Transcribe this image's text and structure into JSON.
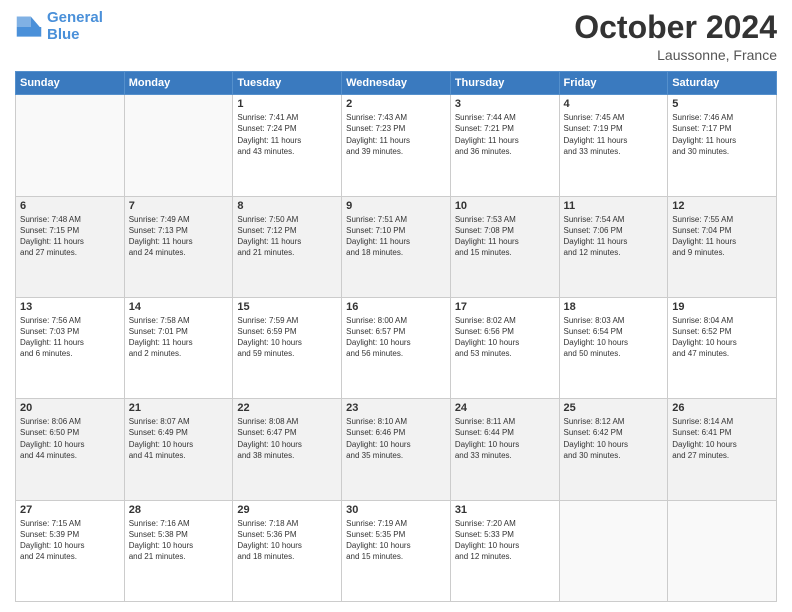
{
  "header": {
    "logo_line1": "General",
    "logo_line2": "Blue",
    "month": "October 2024",
    "location": "Laussonne, France"
  },
  "weekdays": [
    "Sunday",
    "Monday",
    "Tuesday",
    "Wednesday",
    "Thursday",
    "Friday",
    "Saturday"
  ],
  "weeks": [
    [
      {
        "day": "",
        "info": ""
      },
      {
        "day": "",
        "info": ""
      },
      {
        "day": "1",
        "info": "Sunrise: 7:41 AM\nSunset: 7:24 PM\nDaylight: 11 hours\nand 43 minutes."
      },
      {
        "day": "2",
        "info": "Sunrise: 7:43 AM\nSunset: 7:23 PM\nDaylight: 11 hours\nand 39 minutes."
      },
      {
        "day": "3",
        "info": "Sunrise: 7:44 AM\nSunset: 7:21 PM\nDaylight: 11 hours\nand 36 minutes."
      },
      {
        "day": "4",
        "info": "Sunrise: 7:45 AM\nSunset: 7:19 PM\nDaylight: 11 hours\nand 33 minutes."
      },
      {
        "day": "5",
        "info": "Sunrise: 7:46 AM\nSunset: 7:17 PM\nDaylight: 11 hours\nand 30 minutes."
      }
    ],
    [
      {
        "day": "6",
        "info": "Sunrise: 7:48 AM\nSunset: 7:15 PM\nDaylight: 11 hours\nand 27 minutes."
      },
      {
        "day": "7",
        "info": "Sunrise: 7:49 AM\nSunset: 7:13 PM\nDaylight: 11 hours\nand 24 minutes."
      },
      {
        "day": "8",
        "info": "Sunrise: 7:50 AM\nSunset: 7:12 PM\nDaylight: 11 hours\nand 21 minutes."
      },
      {
        "day": "9",
        "info": "Sunrise: 7:51 AM\nSunset: 7:10 PM\nDaylight: 11 hours\nand 18 minutes."
      },
      {
        "day": "10",
        "info": "Sunrise: 7:53 AM\nSunset: 7:08 PM\nDaylight: 11 hours\nand 15 minutes."
      },
      {
        "day": "11",
        "info": "Sunrise: 7:54 AM\nSunset: 7:06 PM\nDaylight: 11 hours\nand 12 minutes."
      },
      {
        "day": "12",
        "info": "Sunrise: 7:55 AM\nSunset: 7:04 PM\nDaylight: 11 hours\nand 9 minutes."
      }
    ],
    [
      {
        "day": "13",
        "info": "Sunrise: 7:56 AM\nSunset: 7:03 PM\nDaylight: 11 hours\nand 6 minutes."
      },
      {
        "day": "14",
        "info": "Sunrise: 7:58 AM\nSunset: 7:01 PM\nDaylight: 11 hours\nand 2 minutes."
      },
      {
        "day": "15",
        "info": "Sunrise: 7:59 AM\nSunset: 6:59 PM\nDaylight: 10 hours\nand 59 minutes."
      },
      {
        "day": "16",
        "info": "Sunrise: 8:00 AM\nSunset: 6:57 PM\nDaylight: 10 hours\nand 56 minutes."
      },
      {
        "day": "17",
        "info": "Sunrise: 8:02 AM\nSunset: 6:56 PM\nDaylight: 10 hours\nand 53 minutes."
      },
      {
        "day": "18",
        "info": "Sunrise: 8:03 AM\nSunset: 6:54 PM\nDaylight: 10 hours\nand 50 minutes."
      },
      {
        "day": "19",
        "info": "Sunrise: 8:04 AM\nSunset: 6:52 PM\nDaylight: 10 hours\nand 47 minutes."
      }
    ],
    [
      {
        "day": "20",
        "info": "Sunrise: 8:06 AM\nSunset: 6:50 PM\nDaylight: 10 hours\nand 44 minutes."
      },
      {
        "day": "21",
        "info": "Sunrise: 8:07 AM\nSunset: 6:49 PM\nDaylight: 10 hours\nand 41 minutes."
      },
      {
        "day": "22",
        "info": "Sunrise: 8:08 AM\nSunset: 6:47 PM\nDaylight: 10 hours\nand 38 minutes."
      },
      {
        "day": "23",
        "info": "Sunrise: 8:10 AM\nSunset: 6:46 PM\nDaylight: 10 hours\nand 35 minutes."
      },
      {
        "day": "24",
        "info": "Sunrise: 8:11 AM\nSunset: 6:44 PM\nDaylight: 10 hours\nand 33 minutes."
      },
      {
        "day": "25",
        "info": "Sunrise: 8:12 AM\nSunset: 6:42 PM\nDaylight: 10 hours\nand 30 minutes."
      },
      {
        "day": "26",
        "info": "Sunrise: 8:14 AM\nSunset: 6:41 PM\nDaylight: 10 hours\nand 27 minutes."
      }
    ],
    [
      {
        "day": "27",
        "info": "Sunrise: 7:15 AM\nSunset: 5:39 PM\nDaylight: 10 hours\nand 24 minutes."
      },
      {
        "day": "28",
        "info": "Sunrise: 7:16 AM\nSunset: 5:38 PM\nDaylight: 10 hours\nand 21 minutes."
      },
      {
        "day": "29",
        "info": "Sunrise: 7:18 AM\nSunset: 5:36 PM\nDaylight: 10 hours\nand 18 minutes."
      },
      {
        "day": "30",
        "info": "Sunrise: 7:19 AM\nSunset: 5:35 PM\nDaylight: 10 hours\nand 15 minutes."
      },
      {
        "day": "31",
        "info": "Sunrise: 7:20 AM\nSunset: 5:33 PM\nDaylight: 10 hours\nand 12 minutes."
      },
      {
        "day": "",
        "info": ""
      },
      {
        "day": "",
        "info": ""
      }
    ]
  ]
}
